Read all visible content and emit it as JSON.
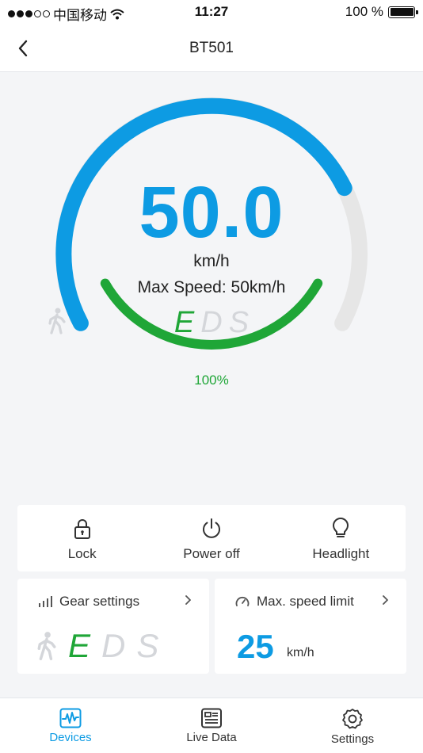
{
  "status_bar": {
    "carrier": "中国移动",
    "time": "11:27",
    "battery": "100 %"
  },
  "navbar": {
    "title": "BT501"
  },
  "gauge": {
    "speed": "50.0",
    "unit": "km/h",
    "max_speed": "Max Speed: 50km/h",
    "modes": [
      "E",
      "D",
      "S"
    ],
    "active_mode": "E",
    "battery_label": "100%",
    "speed_fraction": 0.77,
    "battery_fraction": 1.0
  },
  "actions": [
    {
      "label": "Lock",
      "icon": "lock-icon"
    },
    {
      "label": "Power off",
      "icon": "power-icon"
    },
    {
      "label": "Headlight",
      "icon": "bulb-icon"
    }
  ],
  "gear_card": {
    "title": "Gear settings",
    "modes": [
      "E",
      "D",
      "S"
    ],
    "active_mode": "E"
  },
  "speed_card": {
    "title": "Max. speed limit",
    "value": "25",
    "unit": "km/h"
  },
  "tabs": [
    {
      "label": "Devices",
      "icon": "waveform-icon",
      "active": true
    },
    {
      "label": "Live Data",
      "icon": "dashboard-icon",
      "active": false
    },
    {
      "label": "Settings",
      "icon": "gear-icon",
      "active": false
    }
  ],
  "colors": {
    "accent": "#0d9be3",
    "green": "#1fa637",
    "inactive": "#d4d6da",
    "track": "#e6e6e6"
  }
}
